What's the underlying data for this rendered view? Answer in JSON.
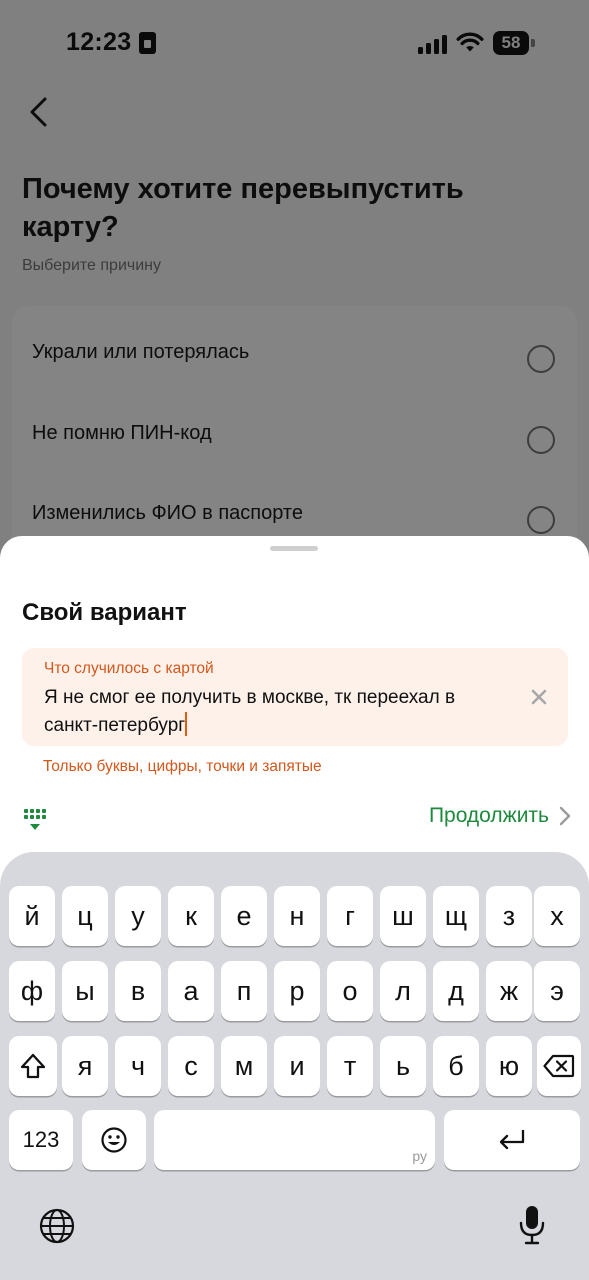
{
  "status_bar": {
    "time": "12:23",
    "battery": "58"
  },
  "screen": {
    "title": "Почему хотите перевыпустить карту?",
    "subtitle": "Выберите причину",
    "options": [
      {
        "label": "Украли или потерялась"
      },
      {
        "label": "Не помню ПИН-код"
      },
      {
        "label": "Изменились ФИО в паспорте"
      }
    ]
  },
  "sheet": {
    "title": "Свой вариант",
    "input": {
      "label": "Что случилось с картой",
      "value": "Я не смог ее получить в москве, тк переехал в санкт-петербург"
    },
    "error": "Только буквы, цифры, точки и запятые",
    "continue_label": "Продолжить"
  },
  "keyboard": {
    "row1": [
      "й",
      "ц",
      "у",
      "к",
      "е",
      "н",
      "г",
      "ш",
      "щ",
      "з",
      "х"
    ],
    "row2": [
      "ф",
      "ы",
      "в",
      "а",
      "п",
      "р",
      "о",
      "л",
      "д",
      "ж",
      "э"
    ],
    "row3": [
      "я",
      "ч",
      "с",
      "м",
      "и",
      "т",
      "ь",
      "б",
      "ю"
    ],
    "numbers_label": "123",
    "language_label": "ру"
  },
  "colors": {
    "accent_orange": "#d4571c",
    "brand_green": "#1e8a3d"
  }
}
